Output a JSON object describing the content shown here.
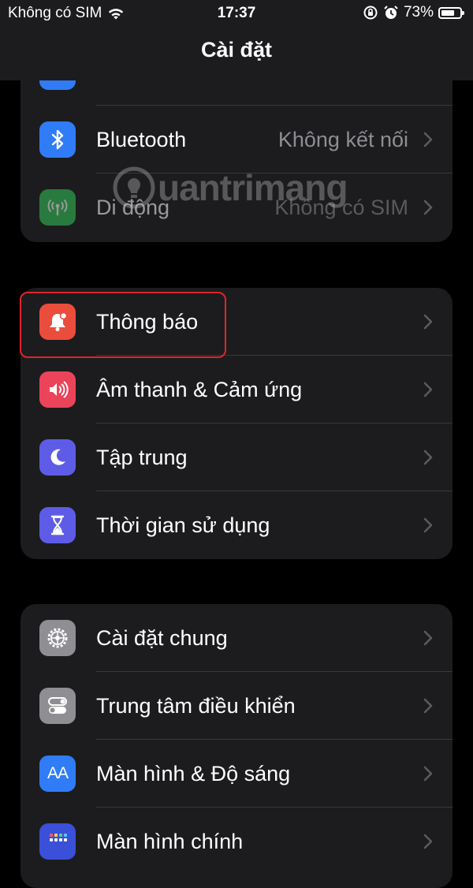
{
  "status_bar": {
    "carrier": "Không có SIM",
    "time": "17:37",
    "battery_percent": "73%",
    "battery_level": 0.73
  },
  "nav": {
    "title": "Cài đặt"
  },
  "watermark": {
    "text": "uantrimang",
    "icon": "lightbulb-icon"
  },
  "groups": [
    {
      "items": [
        {
          "label": "Bluetooth",
          "value": "Không kết nối",
          "icon": "bluetooth-icon",
          "color": "#2f7cf6"
        },
        {
          "label": "Di động",
          "value": "Không có SIM",
          "icon": "antenna-icon",
          "color": "#34c759",
          "disabled": true
        }
      ]
    },
    {
      "items": [
        {
          "label": "Thông báo",
          "icon": "bell-icon",
          "color": "#eb4d3d",
          "highlighted": true
        },
        {
          "label": "Âm thanh & Cảm ứng",
          "icon": "speaker-icon",
          "color": "#eb445a"
        },
        {
          "label": "Tập trung",
          "icon": "moon-icon",
          "color": "#5e5ce6"
        },
        {
          "label": "Thời gian sử dụng",
          "icon": "hourglass-icon",
          "color": "#5e5ce6"
        }
      ]
    },
    {
      "items": [
        {
          "label": "Cài đặt chung",
          "icon": "gear-icon",
          "color": "#8e8e93"
        },
        {
          "label": "Trung tâm điều khiển",
          "icon": "toggles-icon",
          "color": "#8e8e93"
        },
        {
          "label": "Màn hình & Độ sáng",
          "icon": "text-size-icon",
          "color": "#2f7cf6",
          "icon_text": "AA"
        },
        {
          "label": "Màn hình chính",
          "icon": "home-grid-icon",
          "color": "#3a50d9"
        }
      ]
    }
  ]
}
